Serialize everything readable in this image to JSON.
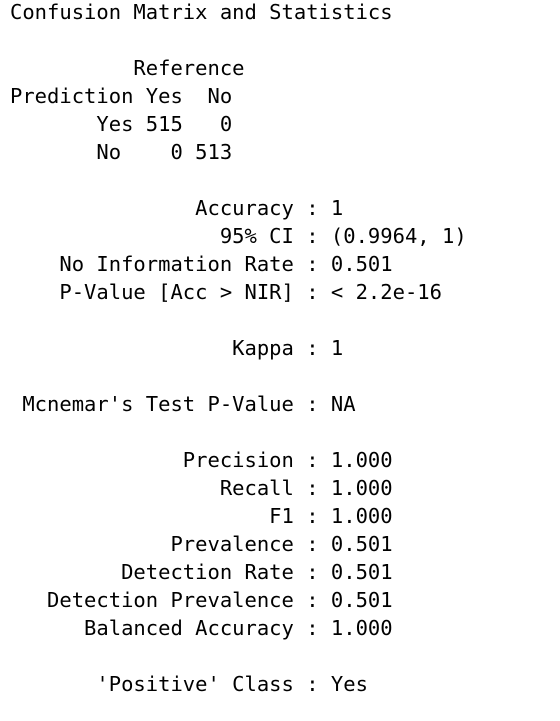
{
  "output": {
    "lines": [
      "Confusion Matrix and Statistics",
      "",
      "          Reference",
      "Prediction Yes  No",
      "       Yes 515   0",
      "       No    0 513",
      "",
      "               Accuracy : 1",
      "                 95% CI : (0.9964, 1)",
      "    No Information Rate : 0.501",
      "    P-Value [Acc > NIR] : < 2.2e-16",
      "",
      "                  Kappa : 1",
      "",
      " Mcnemar's Test P-Value : NA",
      "",
      "              Precision : 1.000",
      "                 Recall : 1.000",
      "                     F1 : 1.000",
      "             Prevalence : 0.501",
      "         Detection Rate : 0.501",
      "   Detection Prevalence : 0.501",
      "      Balanced Accuracy : 1.000",
      "",
      "       'Positive' Class : Yes"
    ]
  }
}
